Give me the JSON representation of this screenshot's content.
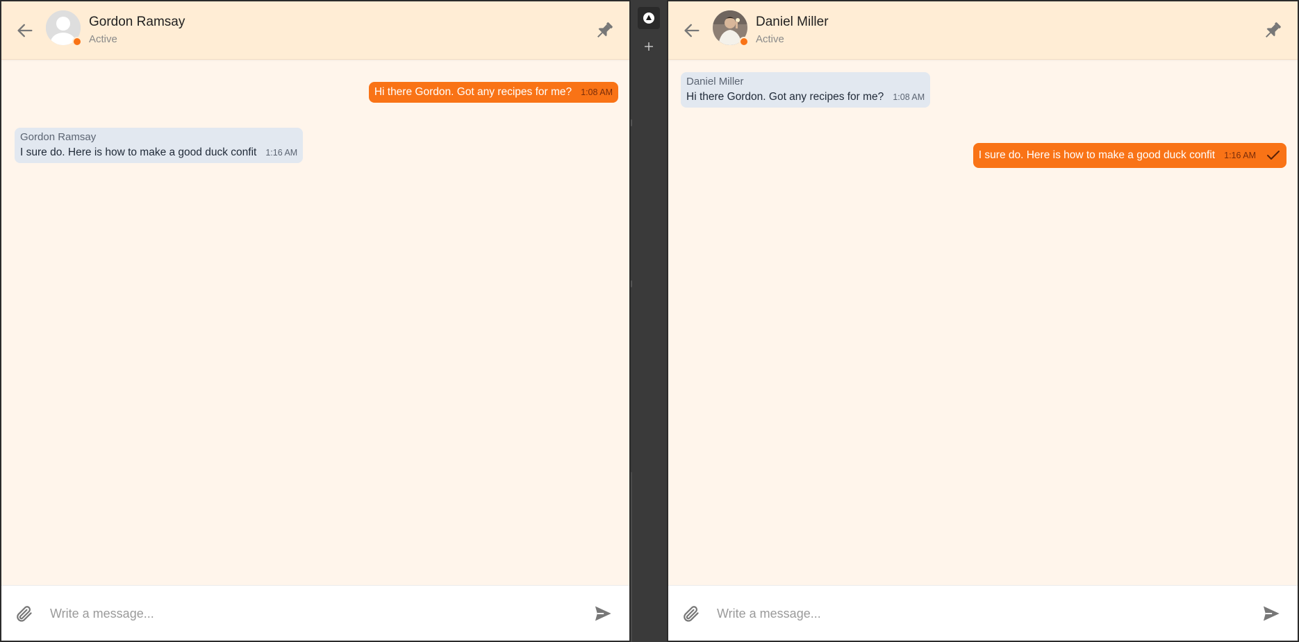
{
  "panes": {
    "left": {
      "contact_name": "Gordon Ramsay",
      "contact_status": "Active",
      "avatar": "default-user-avatar",
      "messages": [
        {
          "direction": "outgoing",
          "text": "Hi there Gordon. Got any recipes for me?",
          "time": "1:08 AM"
        },
        {
          "direction": "incoming",
          "sender": "Gordon Ramsay",
          "text": "I sure do. Here is how to make a good duck confit",
          "time": "1:16 AM"
        }
      ],
      "composer_placeholder": "Write a message..."
    },
    "right": {
      "contact_name": "Daniel Miller",
      "contact_status": "Active",
      "avatar": "photo-avatar",
      "messages": [
        {
          "direction": "incoming",
          "sender": "Daniel Miller",
          "text": "Hi there Gordon. Got any recipes for me?",
          "time": "1:08 AM"
        },
        {
          "direction": "outgoing",
          "text": "I sure do. Here is how to make a good duck confit",
          "time": "1:16 AM",
          "status": "delivered-check-icon"
        }
      ],
      "composer_placeholder": "Write a message..."
    }
  },
  "colors": {
    "accent": "#f97316",
    "header_bg": "#ffedd5",
    "chat_bg": "#fff5eb",
    "incoming_bubble": "#e2e8f0",
    "rail_bg": "#3a3a3a"
  },
  "icons": {
    "back": "arrow-left-icon",
    "pin": "pin-icon",
    "attach": "paperclip-icon",
    "send": "send-icon",
    "rail_top": "triangle-up-icon",
    "rail_add": "plus-icon"
  }
}
